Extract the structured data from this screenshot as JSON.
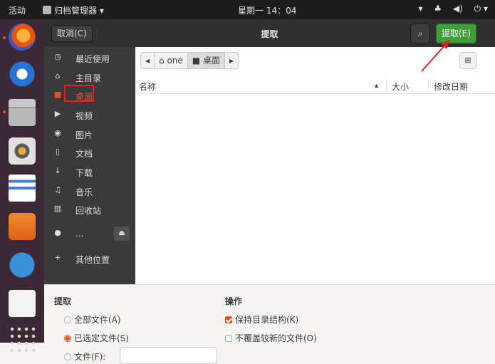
{
  "topbar": {
    "activities": "活动",
    "app_menu": "归档管理器 ▾",
    "clock": "星期一 14：04",
    "tray_network": "♣",
    "tray_sound": "◀)",
    "tray_power": "⏻ ▾",
    "tray_arrow": "▾"
  },
  "header": {
    "cancel_label": "取消(C)",
    "title": "提取",
    "search_icon": "⌕",
    "extract_label": "提取(E)"
  },
  "sidebar": {
    "items": [
      {
        "icon": "◷",
        "label": "最近使用"
      },
      {
        "icon": "⌂",
        "label": "主目录"
      },
      {
        "icon": "■",
        "label": "桌面"
      },
      {
        "icon": "▶",
        "label": "视频"
      },
      {
        "icon": "◉",
        "label": "图片"
      },
      {
        "icon": "▯",
        "label": "文档"
      },
      {
        "icon": "↓",
        "label": "下载"
      },
      {
        "icon": "♫",
        "label": "音乐"
      },
      {
        "icon": "▥",
        "label": "回收站"
      },
      {
        "icon": "●",
        "label": "..."
      },
      {
        "icon": "+",
        "label": "其他位置"
      }
    ],
    "eject_icon": "⏏"
  },
  "pathbar": {
    "back": "◂",
    "home_label": "⌂ one",
    "current_label": "■ 桌面",
    "forward": "▸",
    "new_folder_icon": "⊞"
  },
  "columns": {
    "name": "名称",
    "sort_indicator": "▴",
    "size": "大小",
    "modified": "修改日期"
  },
  "options": {
    "extract_title": "提取",
    "all_files": "全部文件(A)",
    "selected_files": "已选定文件(S)",
    "files": "文件(F):",
    "files_value": "",
    "actions_title": "操作",
    "keep_structure": "保持目录结构(K)",
    "no_overwrite": "不覆盖较新的文件(O)"
  },
  "colors": {
    "accent": "#e95420",
    "extract_button": "#3e9e3a",
    "annotation": "#e02020"
  }
}
